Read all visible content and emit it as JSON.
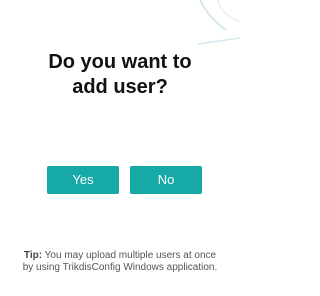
{
  "dialog": {
    "title_line1": "Do you want to",
    "title_line2": "add user?",
    "yes_label": "Yes",
    "no_label": "No"
  },
  "tip": {
    "label": "Tip:",
    "text": "You may upload multiple users at once by using TrikdisConfig Windows application."
  },
  "colors": {
    "accent": "#17a9a6",
    "title": "#111111",
    "tip_text": "#555555",
    "decoration": "#d6e9ef"
  },
  "icons": {
    "decoration": "curve-decoration-icon"
  }
}
